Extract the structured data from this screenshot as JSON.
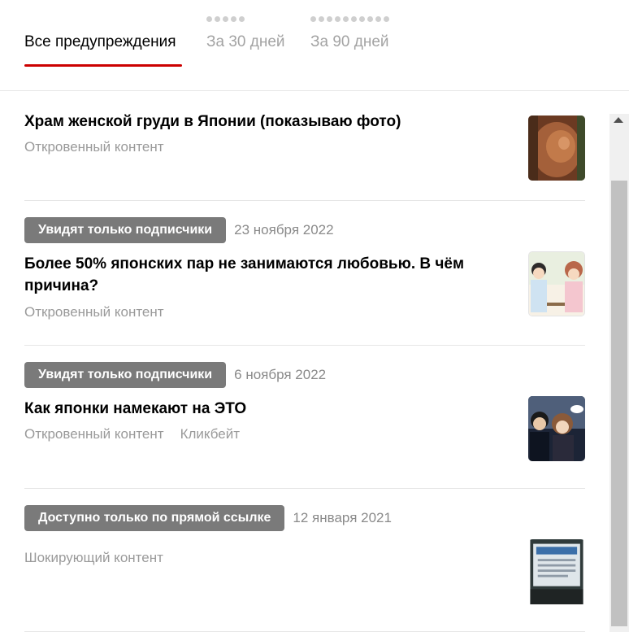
{
  "tabs": [
    {
      "label": "Все предупреждения",
      "active": true
    },
    {
      "label": "За 30 дней",
      "active": false
    },
    {
      "label": "За 90 дней",
      "active": false
    }
  ],
  "items": [
    {
      "badge": "",
      "date": "",
      "title": "Храм женской груди в Японии (показываю фото)",
      "tags": [
        "Откровенный контент"
      ],
      "thumb_icon": "photo-thumbnail"
    },
    {
      "badge": "Увидят только подписчики",
      "date": "23 ноября 2022",
      "title": "Более 50% японских пар не занимаются любовью. В чём причина?",
      "tags": [
        "Откровенный контент"
      ],
      "thumb_icon": "illustration-thumbnail"
    },
    {
      "badge": "Увидят только подписчики",
      "date": "6 ноября 2022",
      "title": "Как японки намекают на ЭТО",
      "tags": [
        "Откровенный контент",
        "Кликбейт"
      ],
      "thumb_icon": "photo-thumbnail"
    },
    {
      "badge": "Доступно только по прямой ссылке",
      "date": "12 января 2021",
      "title": "",
      "tags": [
        "Шокирующий контент"
      ],
      "thumb_icon": "photo-thumbnail"
    }
  ],
  "colors": {
    "accent_underline": "#cc0000",
    "badge_bg": "#7a7a7a",
    "muted_text": "#9a9a9a"
  }
}
